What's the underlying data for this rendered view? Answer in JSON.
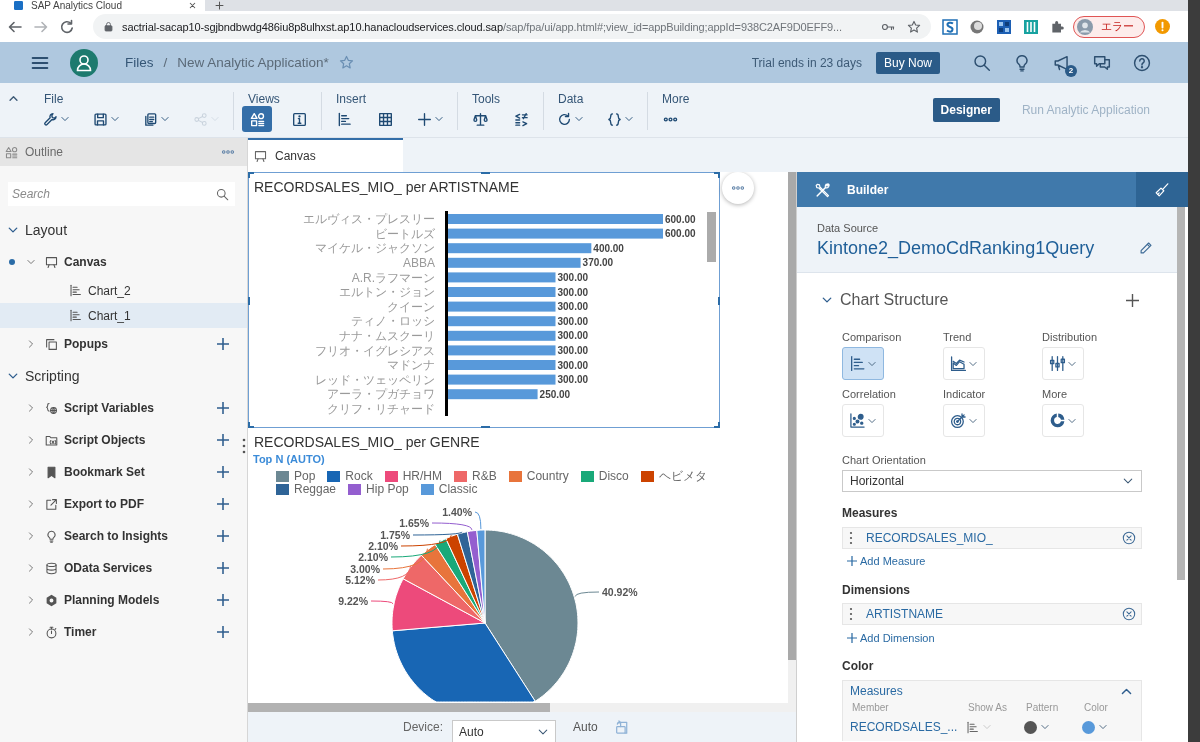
{
  "browser": {
    "tab_title": "SAP Analytics Cloud",
    "url_host": "sactrial-sacap10-sgjbndbwdg486iu8p8ulhxst.ap10.hanacloudservices.cloud.sap",
    "url_path": "/sap/fpa/ui/app.html#;view_id=appBuilding;appId=938C2AF9D0EFF9...",
    "profile_label": "エラー"
  },
  "shell": {
    "breadcrumb": [
      "Files",
      "New Analytic Application*"
    ],
    "separator": "/",
    "favorite": false,
    "trial_notice": "Trial ends in 23 days",
    "buy_button": "Buy Now",
    "notification_count": "2"
  },
  "toolbar": {
    "expanded": true,
    "groups": [
      {
        "label": "File",
        "tools": [
          {
            "dropdown": true,
            "disabled": false
          },
          {
            "dropdown": true,
            "disabled": false
          },
          {
            "dropdown": true,
            "disabled": false
          },
          {
            "dropdown": true,
            "disabled": true
          }
        ]
      },
      {
        "label": "Views",
        "tools": [
          {
            "dropdown": false,
            "disabled": false,
            "selected": true
          },
          {
            "dropdown": false,
            "disabled": false,
            "selected": false
          }
        ]
      },
      {
        "label": "Insert",
        "tools": [
          {
            "dropdown": false,
            "disabled": false
          },
          {
            "dropdown": false,
            "disabled": false
          },
          {
            "dropdown": true,
            "disabled": false
          }
        ]
      },
      {
        "label": "Tools",
        "tools": [
          {
            "dropdown": false,
            "disabled": false
          },
          {
            "dropdown": false,
            "disabled": false
          }
        ]
      },
      {
        "label": "Data",
        "tools": [
          {
            "dropdown": true,
            "disabled": false
          },
          {
            "dropdown": true,
            "disabled": false
          }
        ]
      },
      {
        "label": "More",
        "tools": [
          {
            "dropdown": false,
            "disabled": false
          }
        ]
      }
    ],
    "modes": [
      {
        "label": "Designer",
        "selected": true
      },
      {
        "label": "Run Analytic Application",
        "selected": false
      }
    ]
  },
  "outline": {
    "title": "Outline",
    "search_placeholder": "Search",
    "tree": [
      {
        "label": "Layout",
        "expanded": true,
        "selected": false,
        "children": [
          {
            "label": "Canvas",
            "expanded": true,
            "current": true,
            "selected": false,
            "add_button": false,
            "children": [
              {
                "label": "Chart_2",
                "selected": false
              },
              {
                "label": "Chart_1",
                "selected": true
              }
            ]
          },
          {
            "label": "Popups",
            "expanded": false,
            "current": false,
            "selected": false,
            "add_button": true
          }
        ]
      },
      {
        "label": "Scripting",
        "expanded": true,
        "selected": false,
        "children": [
          {
            "label": "Script Variables",
            "expanded": false,
            "current": false,
            "selected": false,
            "add_button": true
          },
          {
            "label": "Script Objects",
            "expanded": false,
            "current": false,
            "selected": false,
            "add_button": true
          },
          {
            "label": "Bookmark Set",
            "expanded": false,
            "current": false,
            "selected": false,
            "add_button": true
          },
          {
            "label": "Export to PDF",
            "expanded": false,
            "current": false,
            "selected": false,
            "add_button": true
          },
          {
            "label": "Search to Insights",
            "expanded": false,
            "current": false,
            "selected": false,
            "add_button": true
          },
          {
            "label": "OData Services",
            "expanded": false,
            "current": false,
            "selected": false,
            "add_button": true
          },
          {
            "label": "Planning Models",
            "expanded": false,
            "current": false,
            "selected": false,
            "add_button": true
          },
          {
            "label": "Timer",
            "expanded": false,
            "current": false,
            "selected": false,
            "add_button": true
          }
        ]
      }
    ]
  },
  "canvas_tabs": [
    {
      "label": "Canvas",
      "selected": true
    }
  ],
  "canvas": {
    "widgets": [
      {
        "kind": "bar",
        "selected": true,
        "chart_data": {
          "type": "bar",
          "orientation": "horizontal",
          "title": "RECORDSALES_MIO_ per ARTISTNAME",
          "categories": [
            "エルヴィス・プレスリー",
            "ビートルズ",
            "マイケル・ジャクソン",
            "ABBA",
            "A.R.ラフマーン",
            "エルトン・ジョン",
            "クイーン",
            "ティノ・ロッシ",
            "ナナ・ムスクーリ",
            "フリオ・イグレシアス",
            "マドンナ",
            "レッド・ツェッペリン",
            "アーラ・プガチョワ",
            "クリフ・リチャード"
          ],
          "series": [
            {
              "color": "#5899da",
              "values": [
                600,
                600,
                400,
                370,
                300,
                300,
                300,
                300,
                300,
                300,
                300,
                300,
                250,
                null
              ],
              "value_labels": [
                "600.00",
                "600.00",
                "400.00",
                "370.00",
                "300.00",
                "300.00",
                "300.00",
                "300.00",
                "300.00",
                "300.00",
                "300.00",
                "300.00",
                "250.00",
                null
              ]
            }
          ]
        }
      },
      {
        "kind": "pie",
        "selected": false,
        "top_n_label": "Top N (AUTO)",
        "chart_data": {
          "type": "pie",
          "title": "RECORDSALES_MIO_ per GENRE",
          "categories": [
            "Pop",
            "Rock",
            "HR/HM",
            "R&B",
            "Country",
            "Disco",
            "ヘビメタ",
            "Reggae",
            "Hip Pop",
            "Classic"
          ],
          "colors": [
            "#6c8893",
            "#1866b4",
            "#ed4a7b",
            "#ee6868",
            "#e8743b",
            "#19a979",
            "#cc4300",
            "#2f6497",
            "#945ecf",
            "#5899da"
          ],
          "values": [
            40.92,
            32.74,
            9.22,
            5.12,
            3.0,
            2.1,
            2.1,
            1.75,
            1.65,
            1.4
          ],
          "data_labels": true,
          "value_labels": [
            "40.92%",
            null,
            "9.22%",
            "5.12%",
            "3.00%",
            "2.10%",
            "2.10%",
            "1.75%",
            "1.65%",
            "1.40%"
          ]
        }
      }
    ]
  },
  "device_bar": {
    "label": "Device:",
    "device": "Auto",
    "status": "Auto"
  },
  "builder": {
    "title": "Builder",
    "data_source_label": "Data Source",
    "data_source": "Kintone2_DemoCdRanking1Query",
    "chart_structure": {
      "title": "Chart Structure",
      "expanded": true,
      "chart_types": [
        {
          "label": "Comparison",
          "selected": true
        },
        {
          "label": "Trend",
          "selected": false
        },
        {
          "label": "Distribution",
          "selected": false
        },
        {
          "label": "Correlation",
          "selected": false
        },
        {
          "label": "Indicator",
          "selected": false
        },
        {
          "label": "More",
          "selected": false
        }
      ],
      "orientation": {
        "label": "Chart Orientation",
        "value": "Horizontal"
      },
      "measures": {
        "title": "Measures",
        "items": [
          "RECORDSALES_MIO_"
        ],
        "add_link": "Add Measure"
      },
      "dimensions": {
        "title": "Dimensions",
        "items": [
          "ARTISTNAME"
        ],
        "add_link": "Add Dimension"
      },
      "color": {
        "title": "Color",
        "panel": {
          "title": "Measures",
          "expanded": true,
          "columns": [
            "Member",
            "Show As",
            "Pattern",
            "Color"
          ],
          "rows": [
            {
              "member": "RECORDSALES_...",
              "show_as_disabled": true,
              "color": "#5899da"
            }
          ]
        }
      }
    }
  }
}
